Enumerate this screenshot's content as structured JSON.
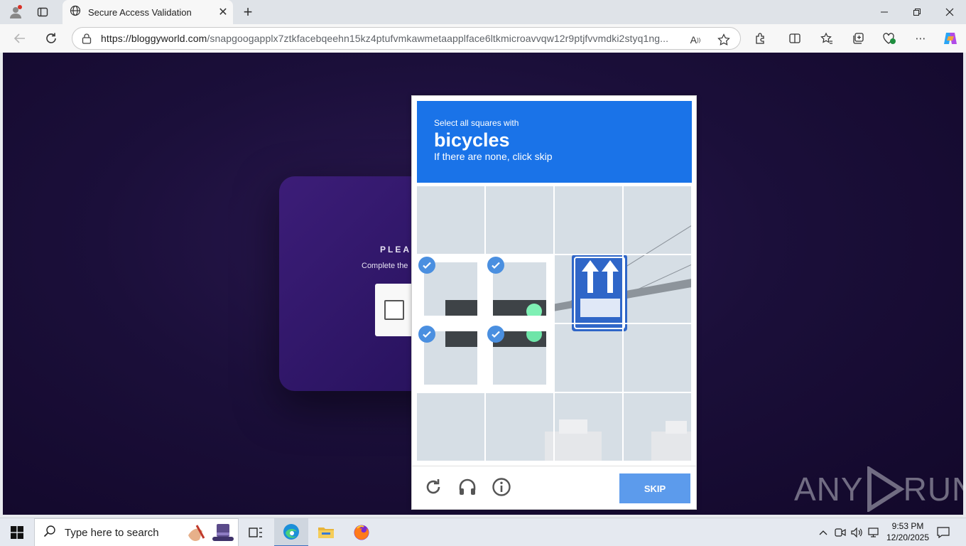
{
  "browser": {
    "tab_title": "Secure Access Validation",
    "url_domain": "https://bloggyworld.com",
    "url_path": "/snapgoogapplx7ztkfacebqeehn15kz4ptufvmkawmetaapplface6ltkmicroavvqw12r9ptjfvvmdki2styq1ng..."
  },
  "page": {
    "heading_partial": "PLEAS",
    "subtext_partial": "Complete the"
  },
  "captcha": {
    "instruction": "Select all squares with",
    "keyword": "bicycles",
    "hint": "If there are none, click skip",
    "skip_label": "SKIP",
    "selected_cells": [
      4,
      5,
      8,
      9
    ],
    "grid_size": 4
  },
  "watermark": {
    "text_left": "ANY",
    "text_right": "RUN"
  },
  "taskbar": {
    "search_placeholder": "Type here to search",
    "time": "9:53 PM",
    "date": "12/20/2025"
  },
  "colors": {
    "captcha_blue": "#1a73e8",
    "skip_blue": "#5c9bec",
    "check_blue": "#4a8fe0",
    "page_bg": "#1b0f3a"
  }
}
